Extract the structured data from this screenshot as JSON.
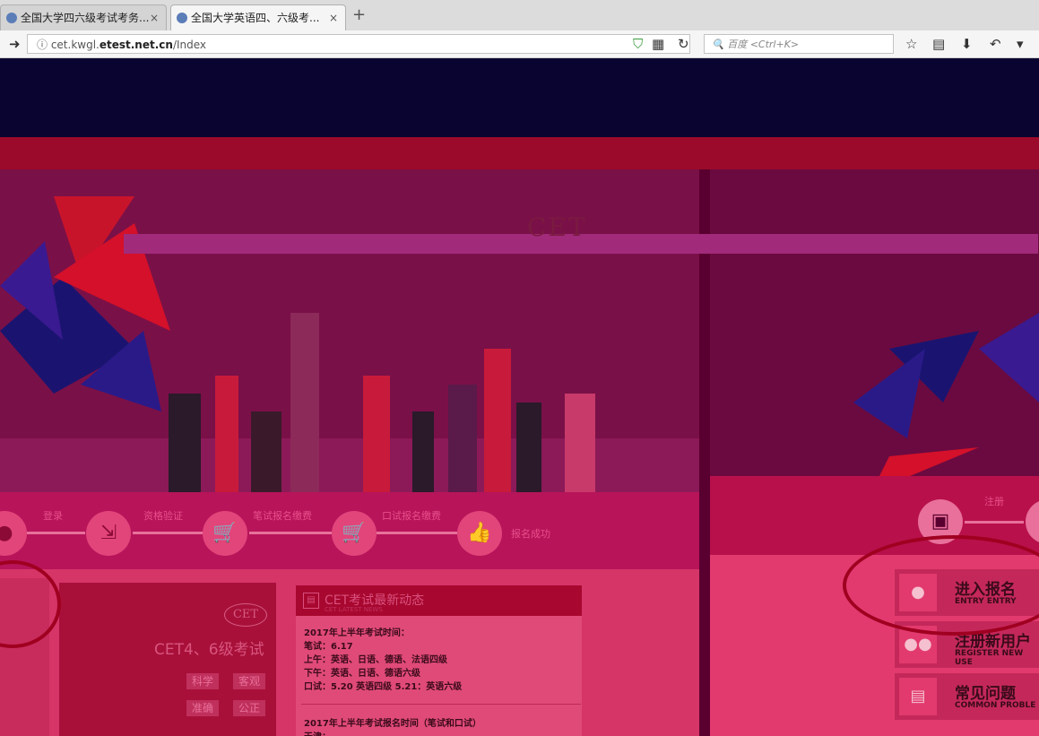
{
  "browser": {
    "tabs": [
      {
        "label": "全国大学四六级考试考务...",
        "active": false
      },
      {
        "label": "全国大学英语四、六级考...",
        "active": true
      }
    ],
    "new_tab": "+",
    "close": "×",
    "url_prefix": "cet.kwgl.",
    "url_domain": "etest.net.cn",
    "url_path": "/Index",
    "search_placeholder": "百度 <Ctrl+K>"
  },
  "page": {
    "logo_text": "CET",
    "steps": [
      "登录",
      "资格验证",
      "笔试报名缴费",
      "口试报名缴费",
      "报名成功"
    ],
    "side_step": "注册",
    "cet_card": {
      "logo": "CET",
      "title": "CET4、6级考试",
      "tags": [
        "科学",
        "客观",
        "准确",
        "公正"
      ]
    },
    "news": {
      "title": "CET考试最新动态",
      "subtitle": "CET LATEST NEWS",
      "lines": [
        "2017年上半年考试时间：",
        "笔试：6.17",
        "上午：英语、日语、德语、法语四级",
        "下午：英语、日语、德语六级",
        "口试：5.20 英语四级   5.21：英语六级",
        "2017年上半年考试报名时间（笔试和口试）",
        "天津："
      ]
    },
    "side_buttons": [
      {
        "main": "进入报名",
        "sub": "ENTRY ENTRY"
      },
      {
        "main": "注册新用户",
        "sub": "REGISTER NEW USE"
      },
      {
        "main": "常见问题",
        "sub": "COMMON PROBLE"
      }
    ]
  }
}
